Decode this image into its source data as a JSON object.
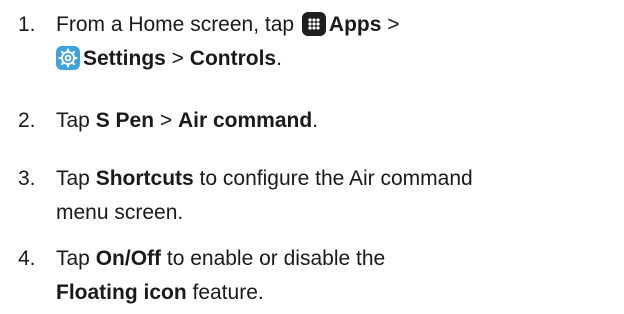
{
  "steps": [
    {
      "number": "1.",
      "line1": {
        "prefix": "From a Home screen, tap ",
        "apps_icon": "apps-icon",
        "apps": "Apps",
        "sep1": " >"
      },
      "line2": {
        "settings_icon": "settings-gear-icon",
        "settings": "Settings",
        "sep2": " > ",
        "controls": "Controls",
        "end": "."
      }
    },
    {
      "number": "2.",
      "prefix": "Tap ",
      "s_pen": "S Pen",
      "sep": " > ",
      "air_command": "Air command",
      "end": "."
    },
    {
      "number": "3.",
      "prefix": "Tap ",
      "shortcuts": "Shortcuts",
      "rest1": " to configure the Air command",
      "line2": "menu screen."
    },
    {
      "number": "4.",
      "prefix": "Tap ",
      "onoff": "On/Off",
      "rest1": " to enable or disable the",
      "floating_icon": "Floating icon",
      "rest2": " feature."
    }
  ],
  "colors": {
    "text": "#1a1a1a",
    "apps_icon_bg": "#1f1f1f",
    "settings_icon_bg": "#3fa2df"
  }
}
